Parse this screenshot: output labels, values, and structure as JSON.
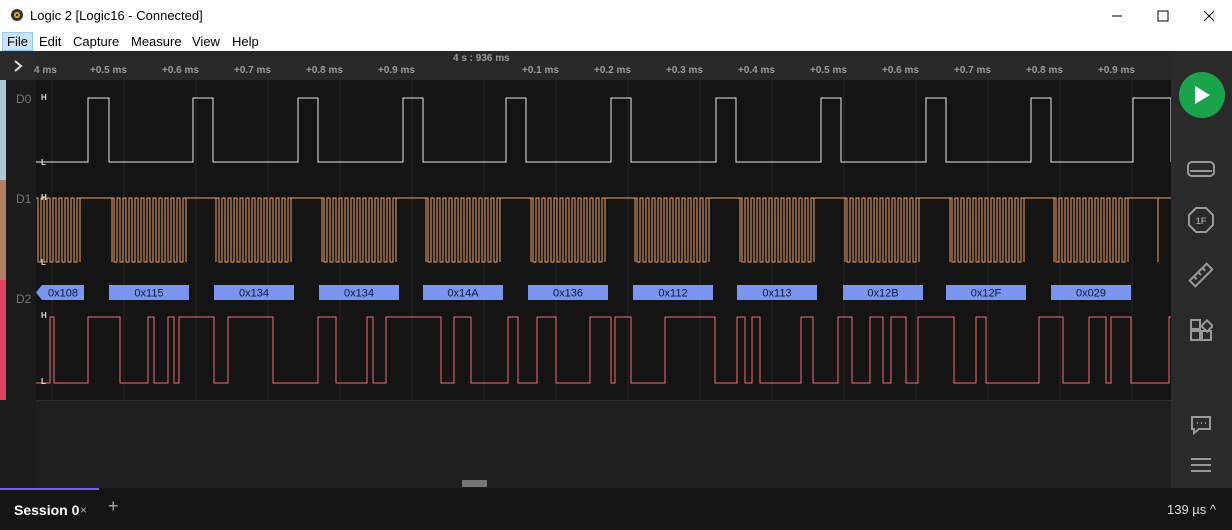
{
  "window": {
    "title": "Logic 2 [Logic16 - Connected]",
    "icons": [
      "app-logo-icon",
      "minimize-icon",
      "maximize-icon",
      "close-icon"
    ]
  },
  "menu": {
    "items": [
      "File",
      "Edit",
      "Capture",
      "Measure",
      "View",
      "Help"
    ]
  },
  "timeline": {
    "center_label": "4 s : 936 ms",
    "ticks": [
      "4 ms",
      "+0.5 ms",
      "+0.6 ms",
      "+0.7 ms",
      "+0.8 ms",
      "+0.9 ms",
      "+0.1 ms",
      "+0.2 ms",
      "+0.3 ms",
      "+0.4 ms",
      "+0.5 ms",
      "+0.6 ms",
      "+0.7 ms",
      "+0.8 ms",
      "+0.9 ms"
    ]
  },
  "channels": [
    {
      "label": "D0",
      "high": "H",
      "low": "L",
      "color": "#b0c8d4",
      "wave_color": "#e8e8e8"
    },
    {
      "label": "D1",
      "high": "H",
      "low": "L",
      "color": "#b08060",
      "wave_color": "#e8a06a"
    },
    {
      "label": "D2",
      "high": "H",
      "low": "L",
      "color": "#e04060",
      "wave_color": "#f07070"
    }
  ],
  "decoded": {
    "color": "#7a94f0",
    "values": [
      "0x108",
      "0x115",
      "0x134",
      "0x134",
      "0x14A",
      "0x136",
      "0x112",
      "0x113",
      "0x12B",
      "0x12F",
      "0x029"
    ]
  },
  "sidebar": {
    "play_color": "#1aa34a",
    "icons": [
      "play-icon",
      "device-icon",
      "analyzer-1f-icon",
      "measure-ruler-icon",
      "extensions-icon",
      "feedback-icon",
      "menu-icon"
    ]
  },
  "bottom": {
    "session_label": "Session 0",
    "close_glyph": "×",
    "add_glyph": "+",
    "timescale": "139 µs ^"
  }
}
